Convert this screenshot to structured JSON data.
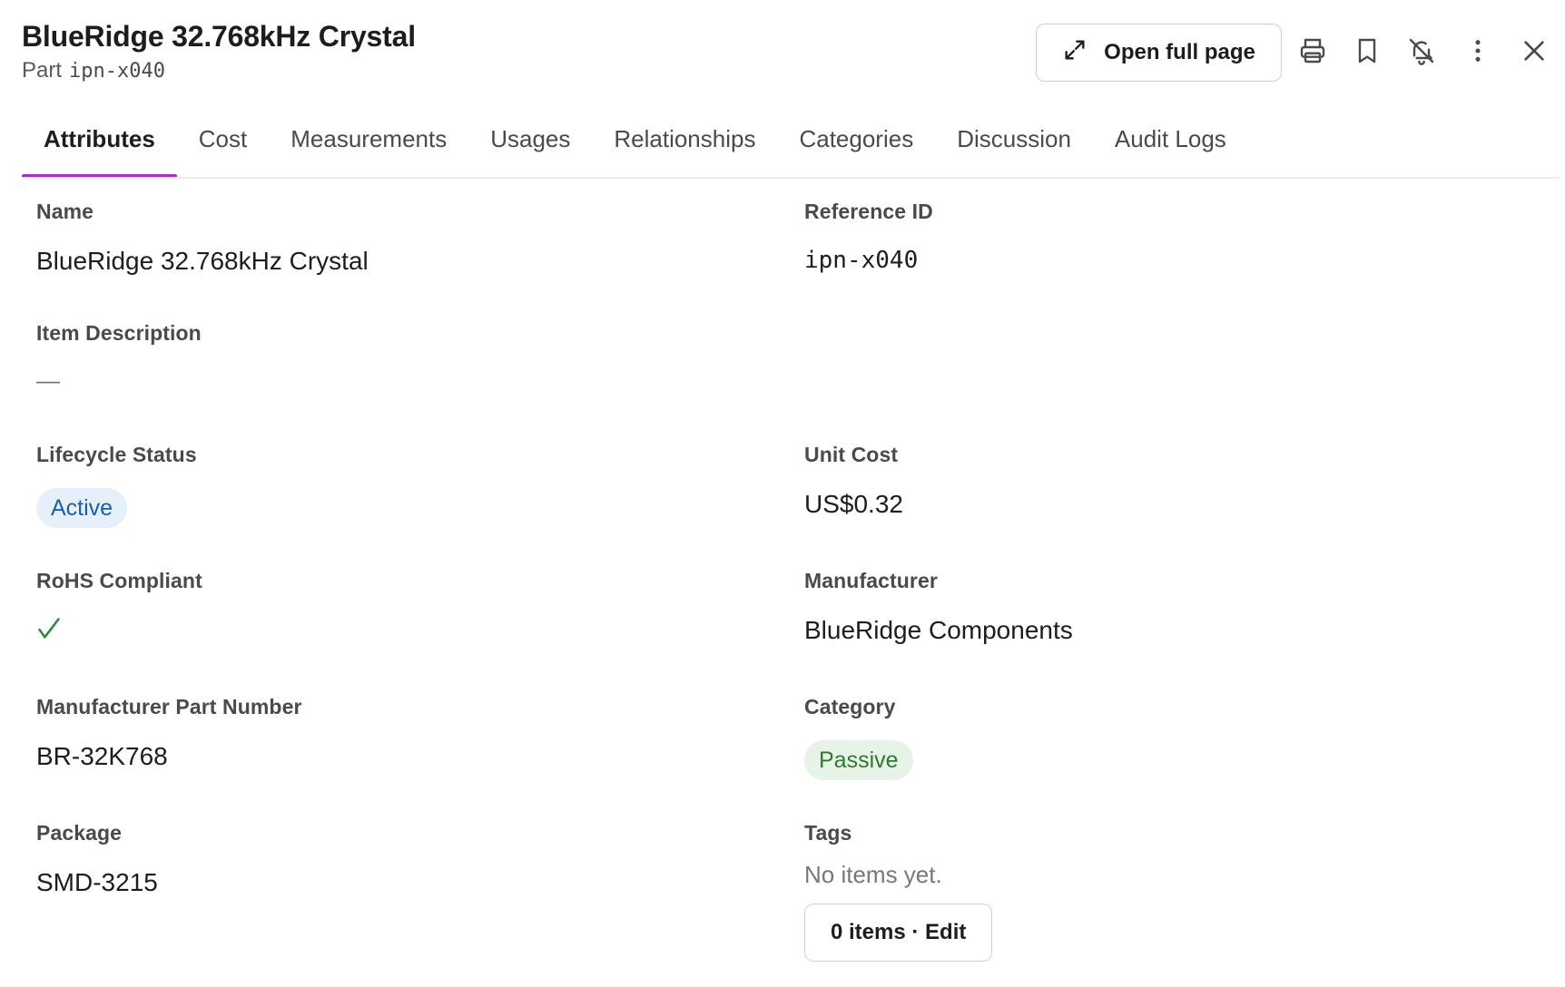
{
  "header": {
    "title": "BlueRidge 32.768kHz Crystal",
    "subtitle_prefix": "Part",
    "subtitle_id": "ipn-x040",
    "open_full_page_label": "Open full page",
    "icons": [
      "expand-icon",
      "print-icon",
      "bookmark-icon",
      "bell-off-icon",
      "more-vertical-icon",
      "close-icon"
    ]
  },
  "tabs": [
    {
      "label": "Attributes",
      "active": true
    },
    {
      "label": "Cost"
    },
    {
      "label": "Measurements"
    },
    {
      "label": "Usages"
    },
    {
      "label": "Relationships"
    },
    {
      "label": "Categories"
    },
    {
      "label": "Discussion"
    },
    {
      "label": "Audit Logs"
    }
  ],
  "fields": {
    "name": {
      "label": "Name",
      "value": "BlueRidge 32.768kHz Crystal"
    },
    "reference_id": {
      "label": "Reference ID",
      "value": "ipn-x040"
    },
    "item_description": {
      "label": "Item Description",
      "value": "—"
    },
    "lifecycle_status": {
      "label": "Lifecycle Status",
      "value": "Active"
    },
    "unit_cost": {
      "label": "Unit Cost",
      "value": "US$0.32"
    },
    "rohs_compliant": {
      "label": "RoHS Compliant",
      "value_icon": "check-icon"
    },
    "manufacturer": {
      "label": "Manufacturer",
      "value": "BlueRidge Components"
    },
    "mpn": {
      "label": "Manufacturer Part Number",
      "value": "BR-32K768"
    },
    "category": {
      "label": "Category",
      "value": "Passive"
    },
    "package": {
      "label": "Package",
      "value": "SMD-3215"
    },
    "tags": {
      "label": "Tags",
      "empty_text": "No items yet.",
      "edit_label": "0 items · Edit"
    }
  },
  "colors": {
    "tab_accent": "#a630c8",
    "status_blue_bg": "#e6f0fb",
    "status_blue_text": "#1a5fae",
    "category_green_bg": "#e6f3e6",
    "category_green_text": "#2e7a34",
    "check_green": "#2e8b3a"
  }
}
